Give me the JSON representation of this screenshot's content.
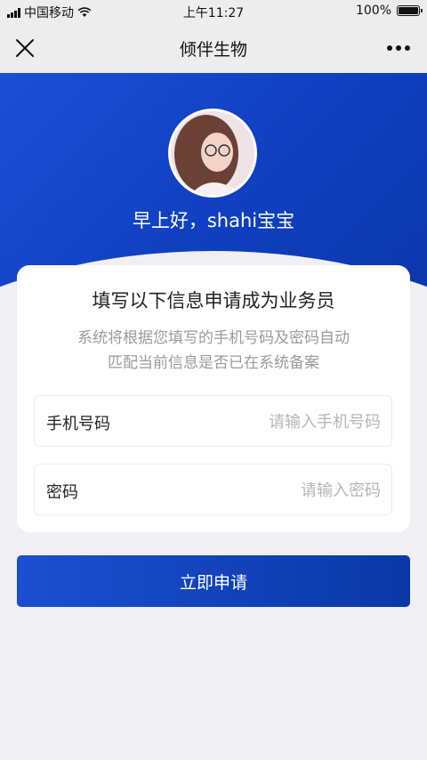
{
  "status_bar": {
    "carrier": "中国移动",
    "time": "上午11:27",
    "battery": "100%"
  },
  "nav": {
    "title": "倾伴生物"
  },
  "hero": {
    "greeting": "早上好，shahi宝宝"
  },
  "card": {
    "title": "填写以下信息申请成为业务员",
    "desc_line1": "系统将根据您填写的手机号码及密码自动",
    "desc_line2": "匹配当前信息是否已在系统备案",
    "phone": {
      "label": "手机号码",
      "value": "",
      "placeholder": "请输入手机号码"
    },
    "password": {
      "label": "密码",
      "value": "",
      "placeholder": "请输入密码"
    }
  },
  "submit": {
    "label": "立即申请"
  },
  "colors": {
    "accent": "#1042c0",
    "background": "#efeff4",
    "placeholder": "#b5b5b5"
  },
  "icons": [
    "signal-icon",
    "wifi-icon",
    "battery-icon",
    "close-icon",
    "more-icon"
  ]
}
